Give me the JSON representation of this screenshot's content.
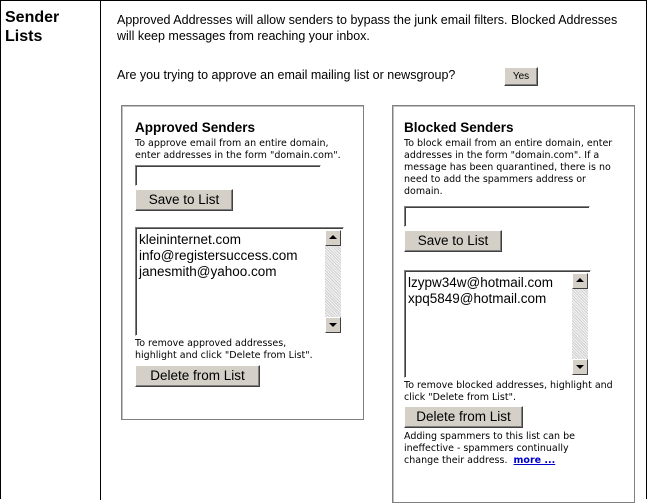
{
  "section": {
    "title": "Sender Lists"
  },
  "intro": {
    "text": "Approved Addresses will allow senders to bypass the junk email filters. Blocked Addresses will keep messages from reaching your inbox.",
    "question": "Are you trying to approve an email mailing list or newsgroup?",
    "yes_label": "Yes"
  },
  "approved": {
    "title": "Approved Senders",
    "hint": "To approve email from an entire domain, enter addresses in the form \"domain.com\".",
    "input_value": "",
    "save_label": "Save to List",
    "items": [
      "kleininternet.com",
      "info@registersuccess.com",
      "janesmith@yahoo.com"
    ],
    "remove_hint": "To remove approved addresses, highlight and click \"Delete from List\".",
    "delete_label": "Delete from List"
  },
  "blocked": {
    "title": "Blocked Senders",
    "hint": "To block email from an entire domain, enter addresses in the form \"domain.com\". If a message has been quarantined, there is no need to add the spammers address or domain.",
    "input_value": "",
    "save_label": "Save to List",
    "items": [
      "lzypw34w@hotmail.com",
      "xpq5849@hotmail.com"
    ],
    "remove_hint": "To remove blocked addresses, highlight and click \"Delete from List\".",
    "delete_label": "Delete from List",
    "warning": "Adding spammers to this list can be ineffective - spammers continually change their address.",
    "more_label": "more ..."
  }
}
